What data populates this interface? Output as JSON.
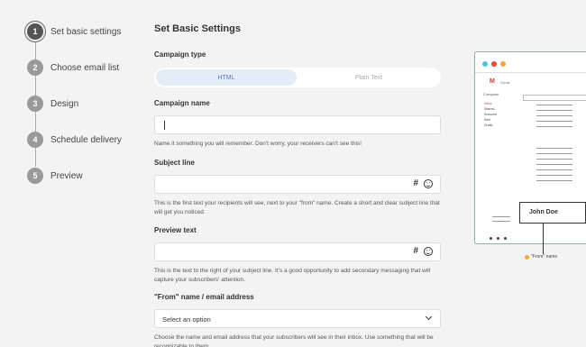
{
  "steps": [
    {
      "num": "1",
      "label": "Set basic settings"
    },
    {
      "num": "2",
      "label": "Choose email list"
    },
    {
      "num": "3",
      "label": "Design"
    },
    {
      "num": "4",
      "label": "Schedule delivery"
    },
    {
      "num": "5",
      "label": "Preview"
    }
  ],
  "form": {
    "title": "Set Basic Settings",
    "campaign_type": {
      "label": "Campaign type",
      "options": [
        "HTML",
        "Plain Text"
      ],
      "selected": "HTML"
    },
    "campaign_name": {
      "label": "Campaign name",
      "value": "",
      "hint": "Name it something you will remember. Don't worry, your receivers can't see this!"
    },
    "subject_line": {
      "label": "Subject line",
      "value": "",
      "hint": "This is the first text your recipients will see, next to your \"from\" name. Create a short and clear subject line that will get you noticed."
    },
    "preview_text": {
      "label": "Preview text",
      "value": "",
      "hint": "This is the text to the right of your subject line. It's a good opportunity to add secondary messaging that will capture your subscribers' attention."
    },
    "from": {
      "label": "\"From\" name / email address",
      "selected": "Select an option",
      "hint": "Choose the name and email address that your subscribers will see in their inbox. Use something that will be recognizable to them."
    }
  },
  "preview": {
    "app_name": "Gmail",
    "logo_letter": "M",
    "compose": "Compose",
    "sidebar": [
      "Inbox",
      "Starred",
      "Snoozed",
      "Sent",
      "Drafts"
    ],
    "name_card": "John Doe",
    "caption": "\"From\" name",
    "window_dots": [
      "#4fc3d9",
      "#e8453c",
      "#f2a93b"
    ]
  }
}
